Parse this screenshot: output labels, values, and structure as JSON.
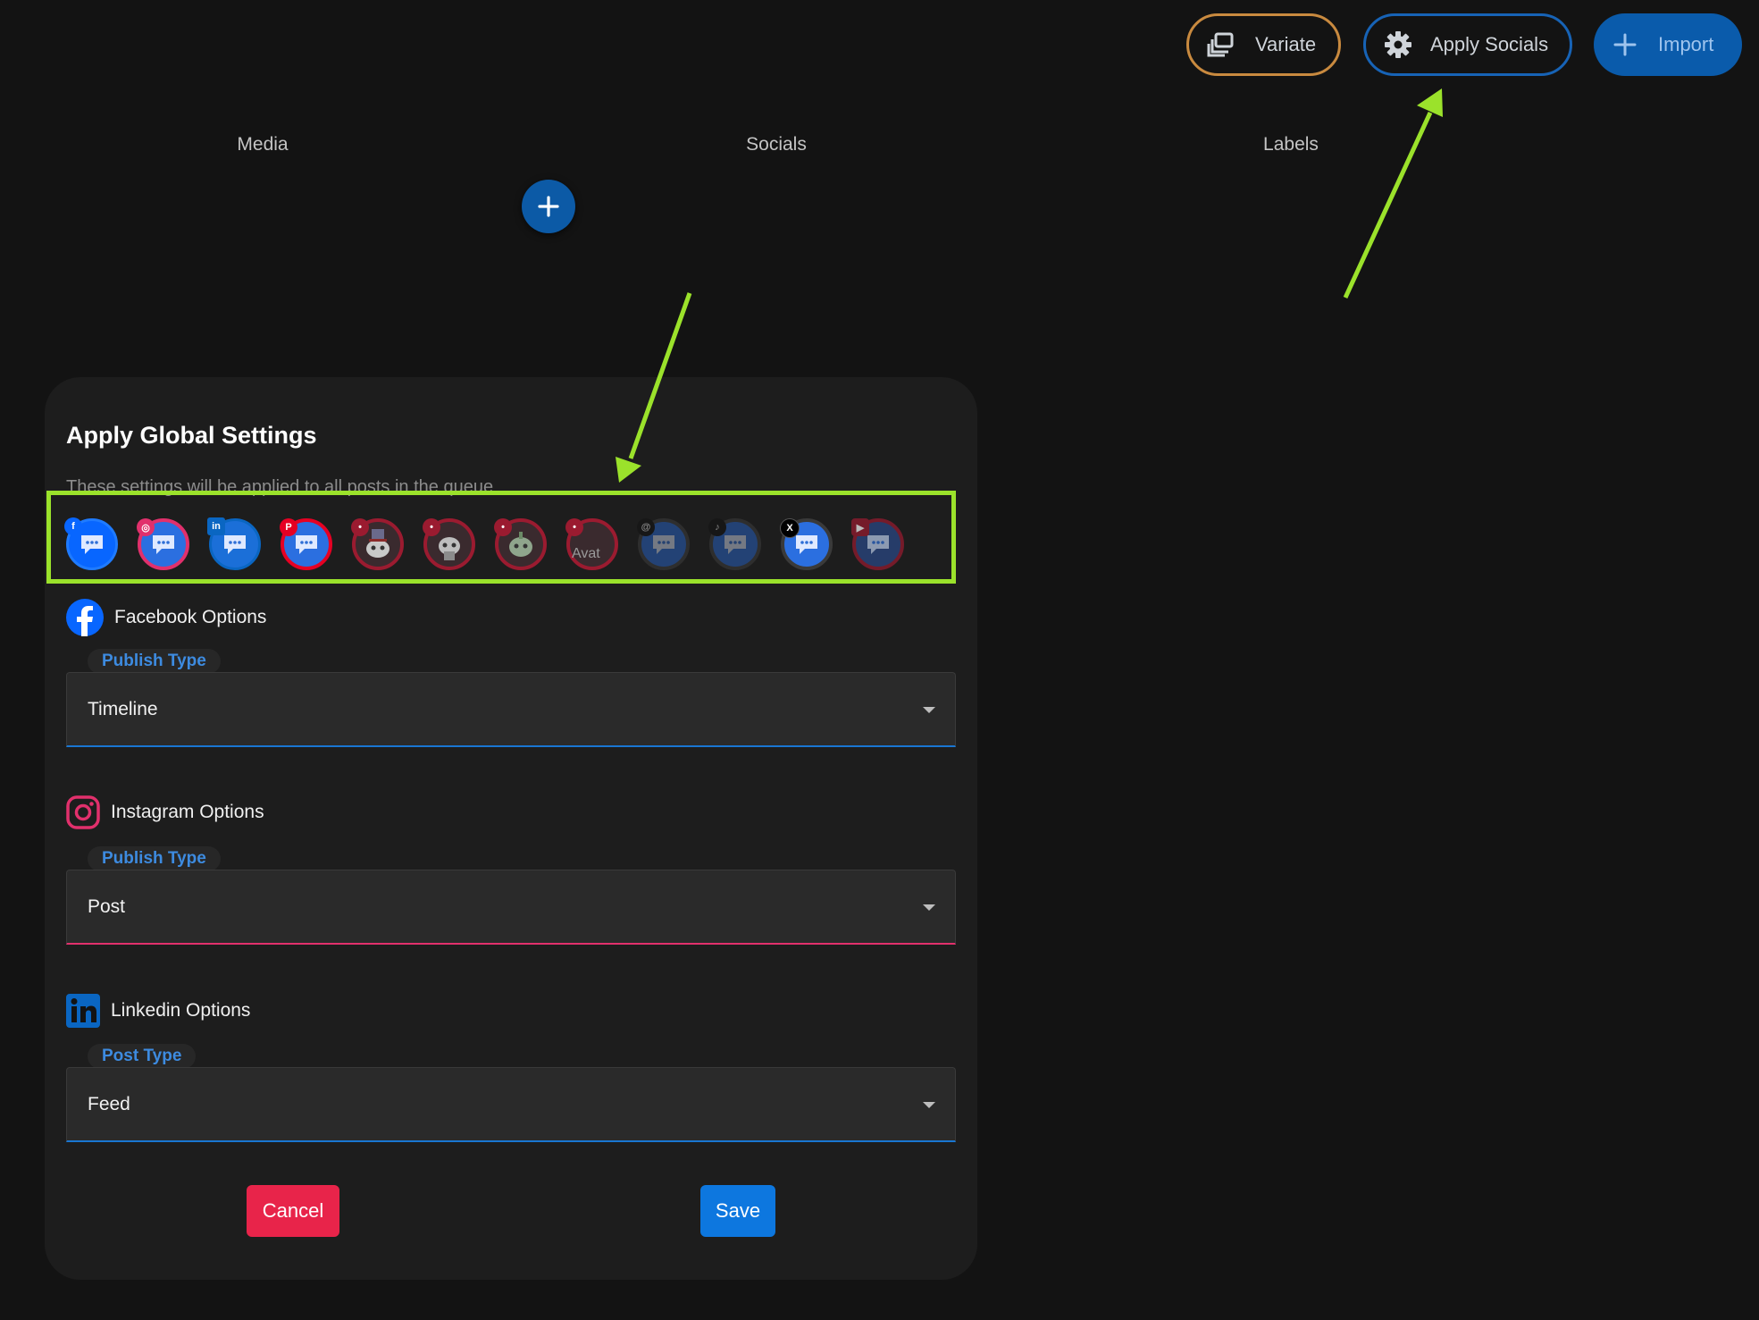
{
  "toolbar": {
    "variate_label": "Variate",
    "apply_socials_label": "Apply Socials",
    "import_label": "Import"
  },
  "columns": [
    "Media",
    "Socials",
    "Labels"
  ],
  "dialog": {
    "title": "Apply Global Settings",
    "subtitle": "These settings will be applied to all posts in the queue",
    "accounts": [
      {
        "network": "facebook",
        "icon": "facebook-icon"
      },
      {
        "network": "instagram",
        "icon": "instagram-icon"
      },
      {
        "network": "linkedin",
        "icon": "linkedin-icon"
      },
      {
        "network": "pinterest",
        "icon": "pinterest-icon"
      },
      {
        "network": "reddit",
        "icon": "reddit-icon"
      },
      {
        "network": "reddit",
        "icon": "reddit-icon"
      },
      {
        "network": "reddit",
        "icon": "reddit-icon"
      },
      {
        "network": "reddit",
        "icon": "reddit-icon",
        "avatar_text": "Avat"
      },
      {
        "network": "threads",
        "icon": "threads-icon"
      },
      {
        "network": "tiktok",
        "icon": "tiktok-icon"
      },
      {
        "network": "x",
        "icon": "x-icon"
      },
      {
        "network": "youtube",
        "icon": "youtube-icon"
      }
    ],
    "facebook": {
      "heading": "Facebook Options",
      "field_label": "Publish Type",
      "value": "Timeline"
    },
    "instagram": {
      "heading": "Instagram Options",
      "field_label": "Publish Type",
      "value": "Post"
    },
    "linkedin": {
      "heading": "Linkedin Options",
      "field_label": "Post Type",
      "value": "Feed"
    },
    "cancel_label": "Cancel",
    "save_label": "Save"
  },
  "colors": {
    "background": "#131313",
    "dialog": "#1d1d1d",
    "highlight": "#9be22b",
    "variate_border": "#c98a3f",
    "apply_border": "#1763b6",
    "import_bg": "#0a5bab",
    "cancel": "#e8244a",
    "save": "#0d77df",
    "facebook_underline": "#1976d2",
    "instagram_underline": "#e1306c"
  }
}
